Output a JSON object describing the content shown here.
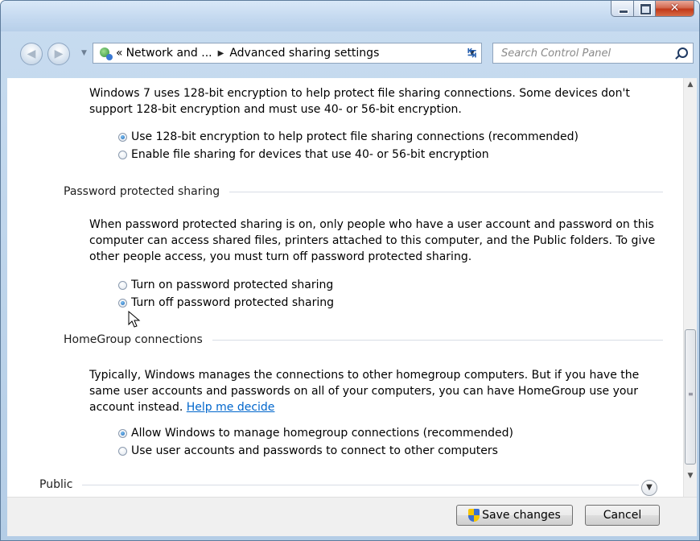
{
  "window": {
    "controls": {
      "minimize": "minimize",
      "maximize": "maximize",
      "close": "close"
    }
  },
  "address_bar": {
    "breadcrumbs": [
      "«",
      "Network and ...",
      "Advanced sharing settings"
    ],
    "icon": "network-icon"
  },
  "search": {
    "placeholder": "Search Control Panel"
  },
  "encryption": {
    "description": "Windows 7 uses 128-bit encryption to help protect file sharing connections. Some devices don't support 128-bit encryption and must use 40- or 56-bit encryption.",
    "options": [
      {
        "label": "Use 128-bit encryption to help protect file sharing connections (recommended)",
        "selected": true
      },
      {
        "label": "Enable file sharing for devices that use 40- or 56-bit encryption",
        "selected": false
      }
    ]
  },
  "password_sharing": {
    "heading": "Password protected sharing",
    "description": "When password protected sharing is on, only people who have a user account and password on this computer can access shared files, printers attached to this computer, and the Public folders. To give other people access, you must turn off password protected sharing.",
    "options": [
      {
        "label": "Turn on password protected sharing",
        "selected": false
      },
      {
        "label": "Turn off password protected sharing",
        "selected": true
      }
    ]
  },
  "homegroup": {
    "heading": "HomeGroup connections",
    "description": "Typically, Windows manages the connections to other homegroup computers. But if you have the same user accounts and passwords on all of your computers, you can have HomeGroup use your account instead.",
    "link": "Help me decide",
    "options": [
      {
        "label": "Allow Windows to manage homegroup connections (recommended)",
        "selected": true
      },
      {
        "label": "Use user accounts and passwords to connect to other computers",
        "selected": false
      }
    ]
  },
  "public_section": {
    "heading": "Public"
  },
  "footer": {
    "save_label": "Save changes",
    "cancel_label": "Cancel"
  },
  "colors": {
    "link": "#0066cc",
    "title_bar": "#c3d8ef",
    "close_button": "#c2391a"
  }
}
